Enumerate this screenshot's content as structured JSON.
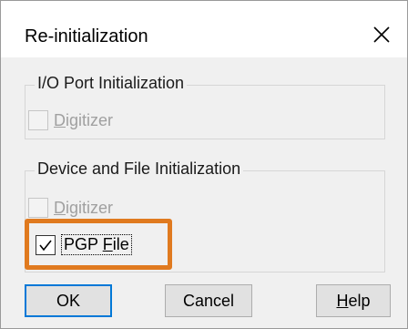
{
  "dialog": {
    "title": "Re-initialization",
    "close_icon": "close-icon"
  },
  "io_group": {
    "legend": "I/O Port Initialization",
    "digitizer": {
      "first": "D",
      "rest": "igitizer",
      "checked": false,
      "enabled": false
    }
  },
  "device_group": {
    "legend": "Device and File Initialization",
    "digitizer": {
      "first": "D",
      "rest": "igitizer",
      "checked": false,
      "enabled": false
    },
    "pgp_file": {
      "pre": "PGP ",
      "first": "F",
      "rest": "ile",
      "checked": true,
      "enabled": true
    }
  },
  "buttons": {
    "ok": "OK",
    "cancel": "Cancel",
    "help_first": "H",
    "help_rest": "elp"
  },
  "colors": {
    "highlight": "#e07a1f",
    "default_button_border": "#0078d7"
  }
}
